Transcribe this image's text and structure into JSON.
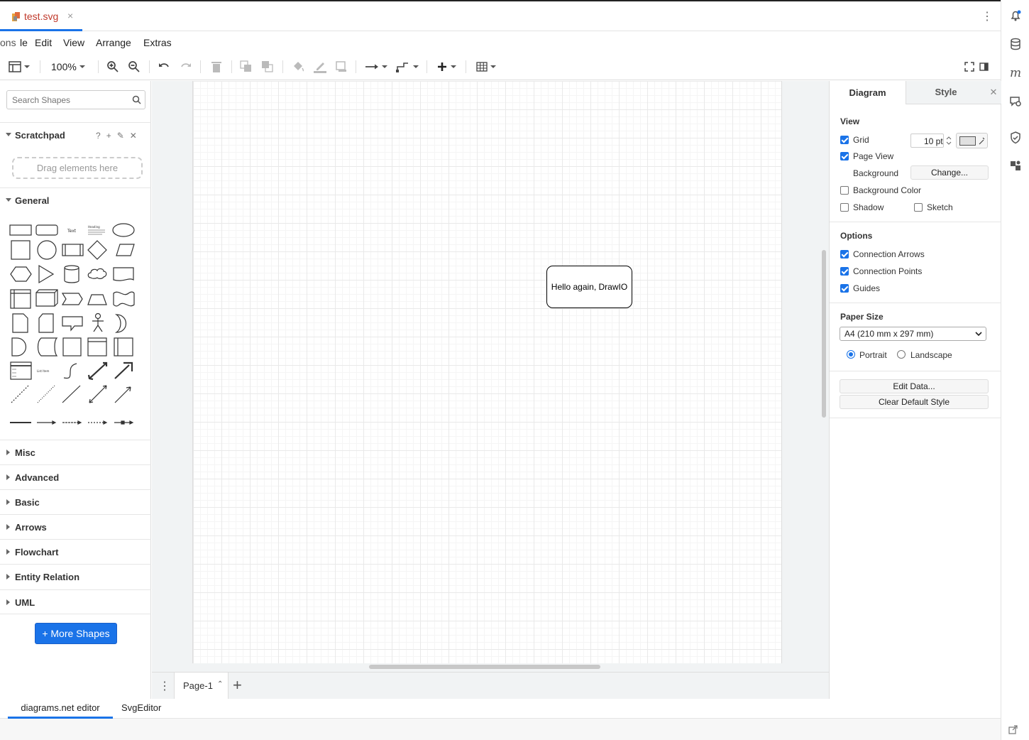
{
  "file_tab": {
    "name": "test.svg",
    "close": "×"
  },
  "menu": {
    "partial": "ons",
    "file": "le",
    "edit": "Edit",
    "view": "View",
    "arrange": "Arrange",
    "extras": "Extras"
  },
  "toolbar": {
    "zoom": "100%"
  },
  "left": {
    "search_placeholder": "Search Shapes",
    "scratchpad": "Scratchpad",
    "scratch_tools": [
      "?",
      "+",
      "✎",
      "✕"
    ],
    "dropzone": "Drag elements here",
    "general": "General",
    "sections": [
      "Misc",
      "Advanced",
      "Basic",
      "Arrows",
      "Flowchart",
      "Entity Relation",
      "UML"
    ],
    "more_shapes": "More Shapes",
    "shape_texts": {
      "text": "Text",
      "heading": "Heading",
      "list_item": "List Item"
    }
  },
  "canvas": {
    "node_text": "Hello again, DrawIO"
  },
  "pages": {
    "current": "Page-1"
  },
  "right": {
    "tab_diagram": "Diagram",
    "tab_style": "Style",
    "close": "✕",
    "view_title": "View",
    "grid": "Grid",
    "grid_size": "10 pt",
    "page_view": "Page View",
    "background": "Background",
    "change": "Change...",
    "background_color": "Background Color",
    "shadow": "Shadow",
    "sketch": "Sketch",
    "options_title": "Options",
    "connection_arrows": "Connection Arrows",
    "connection_points": "Connection Points",
    "guides": "Guides",
    "paper_title": "Paper Size",
    "paper_size": "A4 (210 mm x 297 mm)",
    "portrait": "Portrait",
    "landscape": "Landscape",
    "edit_data": "Edit Data...",
    "clear_default_style": "Clear Default Style",
    "checks": {
      "grid": true,
      "page_view": true,
      "background_color": false,
      "shadow": false,
      "sketch": false,
      "connection_arrows": true,
      "connection_points": true,
      "guides": true
    },
    "orientation": "portrait"
  },
  "bottom_tabs": {
    "diagrams": "diagrams.net editor",
    "svg": "SvgEditor"
  },
  "colors": {
    "accent": "#1a73e8",
    "file_name": "#c0392b"
  }
}
